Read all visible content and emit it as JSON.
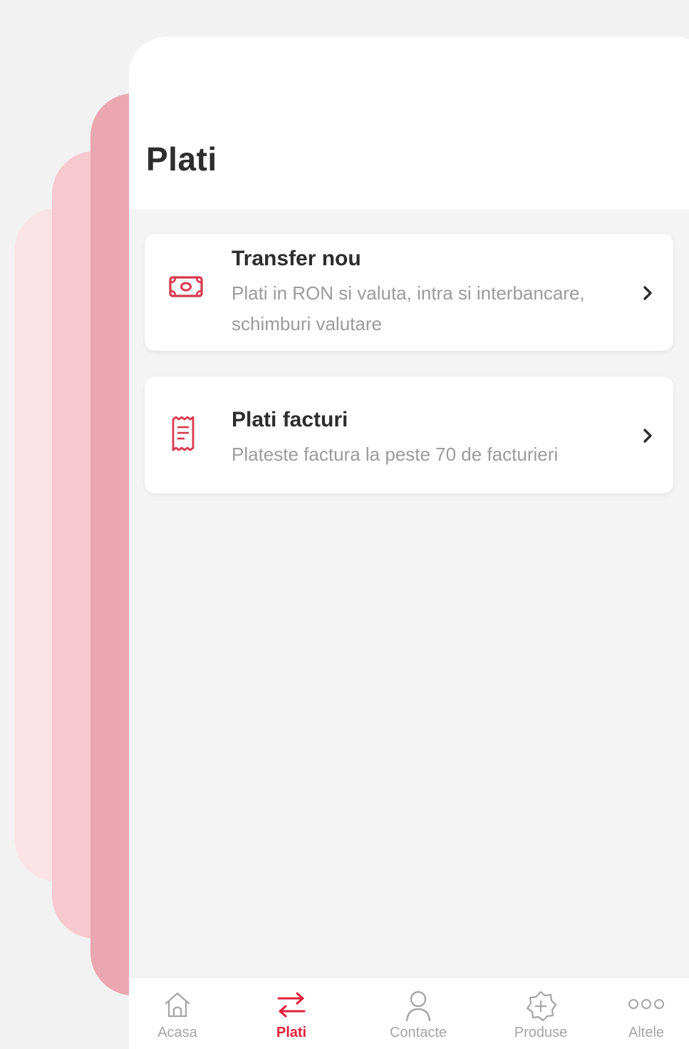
{
  "header": {
    "title": "Plati"
  },
  "cards": [
    {
      "title": "Transfer nou",
      "description": "Plati in RON si valuta, intra si interbancare, schimburi valutare",
      "icon": "banknote-icon"
    },
    {
      "title": "Plati facturi",
      "description": "Plateste factura la peste 70 de facturieri",
      "icon": "receipt-icon"
    }
  ],
  "nav": {
    "items": [
      {
        "label": "Acasa",
        "icon": "home-icon",
        "active": false
      },
      {
        "label": "Plati",
        "icon": "transfer-arrows-icon",
        "active": true
      },
      {
        "label": "Contacte",
        "icon": "person-icon",
        "active": false
      },
      {
        "label": "Produse",
        "icon": "plus-badge-icon",
        "active": false
      },
      {
        "label": "Altele",
        "icon": "more-dots-icon",
        "active": false
      }
    ]
  },
  "colors": {
    "accent": "#e3203a",
    "icon_red": "#d8394e",
    "muted": "#a5a5a5",
    "title": "#2d2d2d"
  }
}
